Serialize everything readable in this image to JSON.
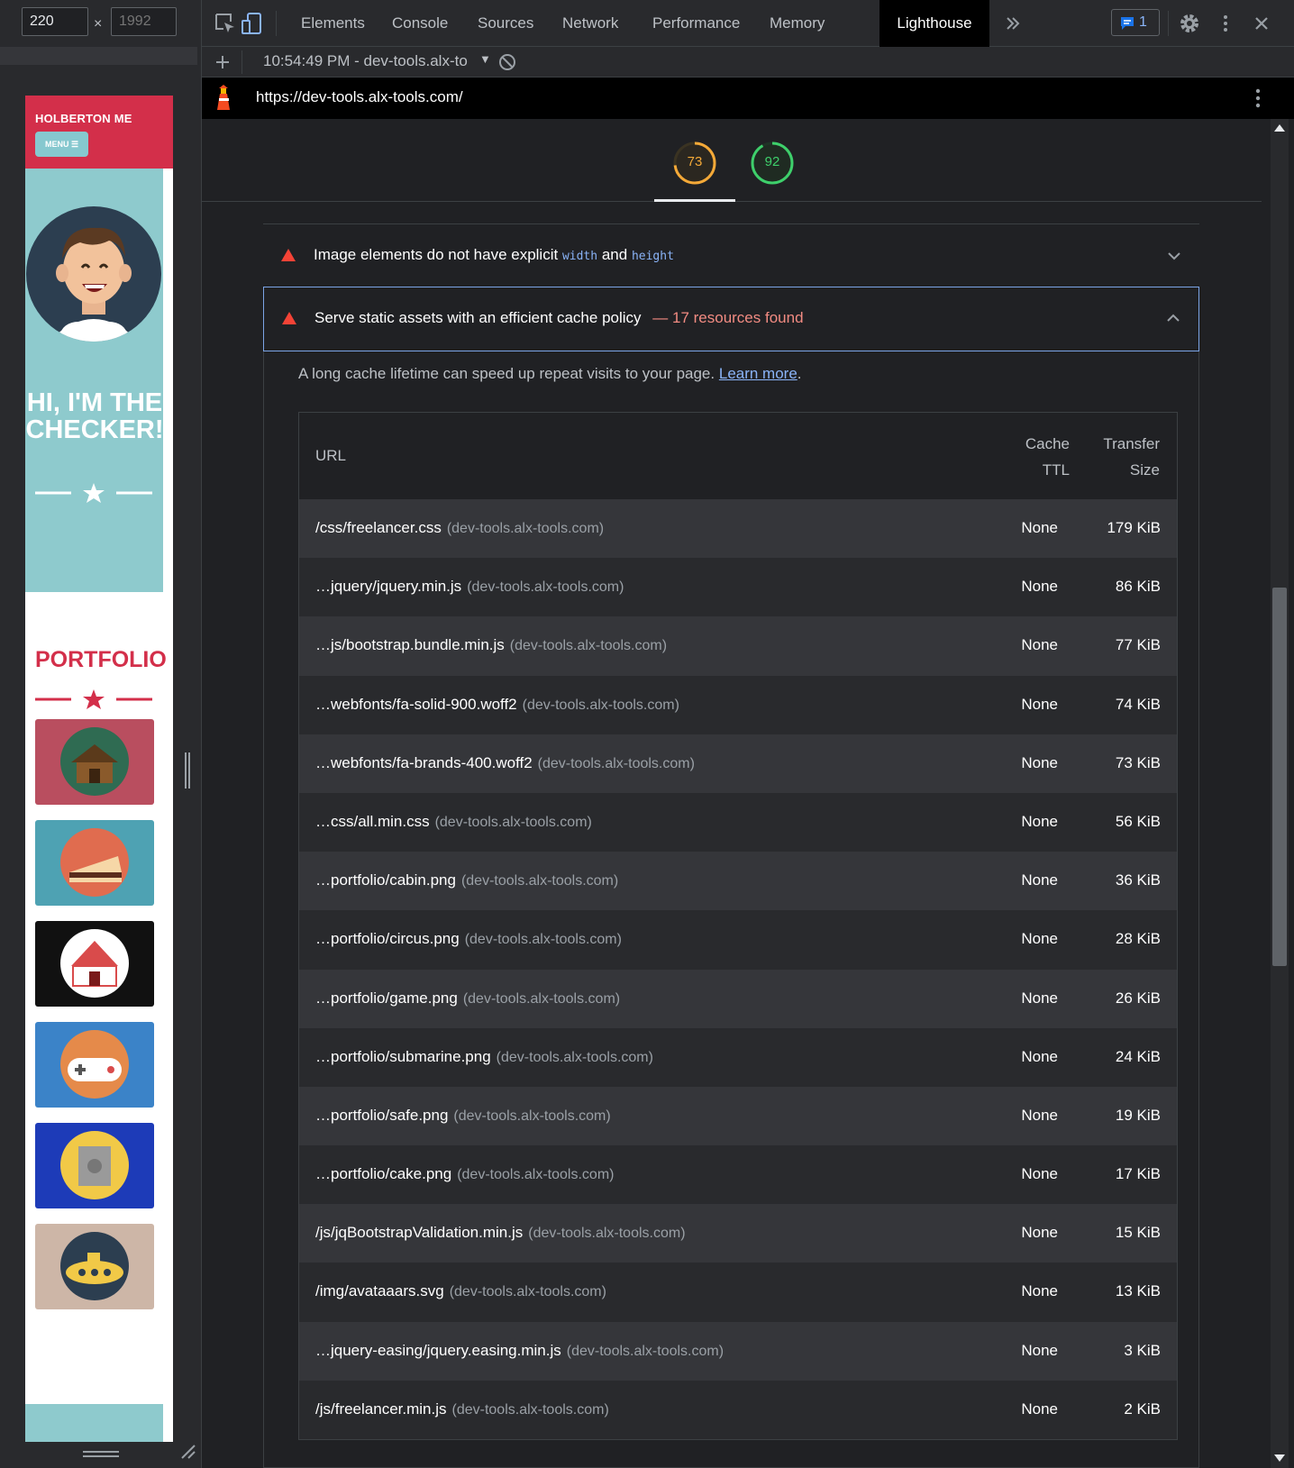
{
  "device": {
    "width_value": "220",
    "height_placeholder": "1992",
    "times_sign": "×"
  },
  "site": {
    "brand": "HOLBERTON ME",
    "menu_label": "MENU ☰",
    "masthead_title": "HI, I'M THE CHECKER!",
    "portfolio_heading": "PORTFOLIO",
    "tile_colors": [
      "#b94e5f",
      "#4ea2b3",
      "#111111",
      "#3b83c8",
      "#1d3bb8",
      "#cdb6a7"
    ]
  },
  "devtools": {
    "tabs": [
      "Elements",
      "Console",
      "Sources",
      "Network",
      "Performance",
      "Memory",
      "Lighthouse"
    ],
    "active_tab": "Lighthouse",
    "issues_count": "1",
    "report_select": "10:54:49 PM - dev-tools.alx-to",
    "url": "https://dev-tools.alx-tools.com/"
  },
  "scores": [
    {
      "value": "73",
      "color": "#f4a938"
    },
    {
      "value": "92",
      "color": "#3ecf6b"
    }
  ],
  "audits": {
    "images": {
      "title_pre": "Image elements do not have explicit",
      "code_1": "width",
      "title_mid": "and",
      "code_2": "height"
    },
    "cache": {
      "title": "Serve static assets with an efficient cache policy",
      "summary": "— 17 resources found",
      "description": "A long cache lifetime can speed up repeat visits to your page.",
      "learn_more": "Learn more",
      "period": ".",
      "columns": {
        "url": "URL",
        "ttl_line1": "Cache",
        "ttl_line2": "TTL",
        "size_line1": "Transfer",
        "size_line2": "Size"
      },
      "rows": [
        {
          "url": "/css/freelancer.css",
          "host": "(dev-tools.alx-tools.com)",
          "ttl": "None",
          "size": "179 KiB"
        },
        {
          "url": "…jquery/jquery.min.js",
          "host": "(dev-tools.alx-tools.com)",
          "ttl": "None",
          "size": "86 KiB"
        },
        {
          "url": "…js/bootstrap.bundle.min.js",
          "host": "(dev-tools.alx-tools.com)",
          "ttl": "None",
          "size": "77 KiB"
        },
        {
          "url": "…webfonts/fa-solid-900.woff2",
          "host": "(dev-tools.alx-tools.com)",
          "ttl": "None",
          "size": "74 KiB"
        },
        {
          "url": "…webfonts/fa-brands-400.woff2",
          "host": "(dev-tools.alx-tools.com)",
          "ttl": "None",
          "size": "73 KiB"
        },
        {
          "url": "…css/all.min.css",
          "host": "(dev-tools.alx-tools.com)",
          "ttl": "None",
          "size": "56 KiB"
        },
        {
          "url": "…portfolio/cabin.png",
          "host": "(dev-tools.alx-tools.com)",
          "ttl": "None",
          "size": "36 KiB"
        },
        {
          "url": "…portfolio/circus.png",
          "host": "(dev-tools.alx-tools.com)",
          "ttl": "None",
          "size": "28 KiB"
        },
        {
          "url": "…portfolio/game.png",
          "host": "(dev-tools.alx-tools.com)",
          "ttl": "None",
          "size": "26 KiB"
        },
        {
          "url": "…portfolio/submarine.png",
          "host": "(dev-tools.alx-tools.com)",
          "ttl": "None",
          "size": "24 KiB"
        },
        {
          "url": "…portfolio/safe.png",
          "host": "(dev-tools.alx-tools.com)",
          "ttl": "None",
          "size": "19 KiB"
        },
        {
          "url": "…portfolio/cake.png",
          "host": "(dev-tools.alx-tools.com)",
          "ttl": "None",
          "size": "17 KiB"
        },
        {
          "url": "/js/jqBootstrapValidation.min.js",
          "host": "(dev-tools.alx-tools.com)",
          "ttl": "None",
          "size": "15 KiB"
        },
        {
          "url": "/img/avataaars.svg",
          "host": "(dev-tools.alx-tools.com)",
          "ttl": "None",
          "size": "13 KiB"
        },
        {
          "url": "…jquery-easing/jquery.easing.min.js",
          "host": "(dev-tools.alx-tools.com)",
          "ttl": "None",
          "size": "3 KiB"
        },
        {
          "url": "/js/freelancer.min.js",
          "host": "(dev-tools.alx-tools.com)",
          "ttl": "None",
          "size": "2 KiB"
        }
      ]
    }
  },
  "icons": [
    "inspect-icon",
    "device-toolbar-icon",
    "more-tabs-icon",
    "issues-icon",
    "settings-icon",
    "kebab-menu-icon",
    "close-icon",
    "add-icon",
    "clear-icon",
    "lighthouse-icon",
    "url-menu-icon",
    "fail-triangle-icon",
    "chevron-down-icon",
    "chevron-up-icon",
    "star-icon"
  ]
}
